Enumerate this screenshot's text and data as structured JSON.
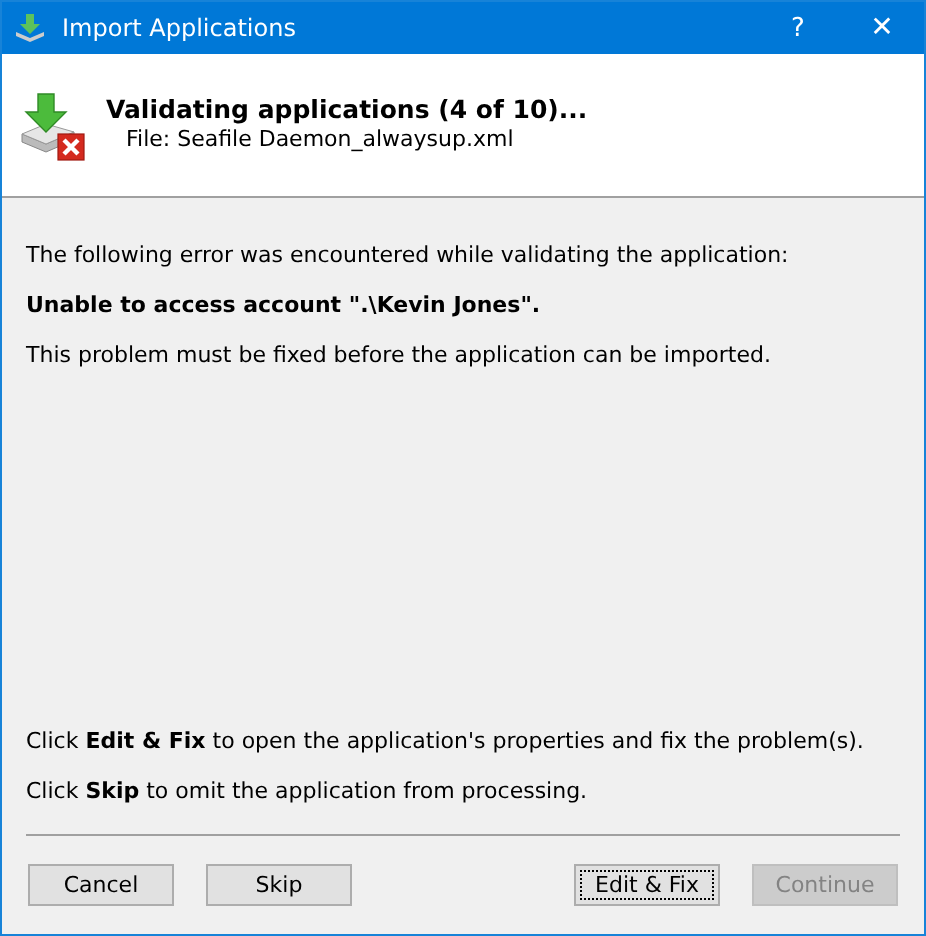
{
  "window": {
    "title": "Import Applications",
    "help_glyph": "?",
    "close_glyph": "✕"
  },
  "header": {
    "title": "Validating applications (4 of 10)...",
    "subtitle": "File: Seafile Daemon_alwaysup.xml"
  },
  "messages": [
    "The following error was encountered while validating the application:",
    "**Unable to access account \".\\Kevin Jones\".**",
    "This problem must be fixed before the application can be imported."
  ],
  "instructions": [
    "Click **Edit & Fix** to open the application's properties and fix the problem(s).",
    "Click **Skip** to omit the application from processing."
  ],
  "buttons": [
    {
      "label": "Cancel",
      "disabled": false,
      "focused": false
    },
    {
      "label": "Skip",
      "disabled": false,
      "focused": false
    },
    {
      "label": "Edit & Fix",
      "disabled": false,
      "focused": true
    },
    {
      "label": "Continue",
      "disabled": true,
      "focused": false
    }
  ]
}
